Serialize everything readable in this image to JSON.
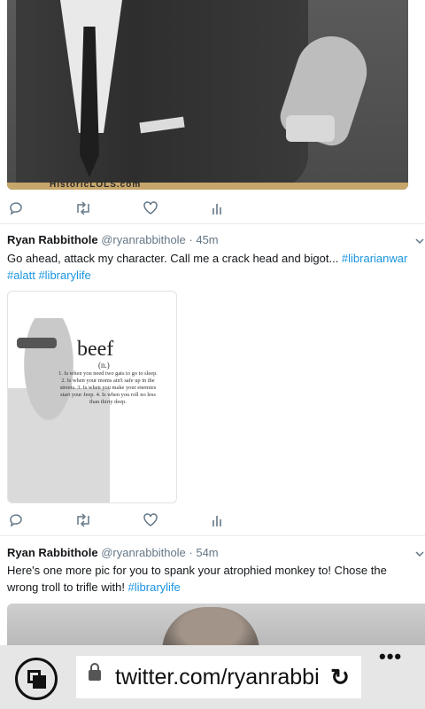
{
  "tweets": [
    {
      "image_watermark": "HistoricLOLS.com"
    },
    {
      "name": "Ryan Rabbithole",
      "meta": "@ryanrabbithole · 45m",
      "text_plain": "Go ahead, attack my character. Call me a crack head and bigot... ",
      "hashtags": [
        "#librarianwar",
        "#alatt",
        "#librarylife"
      ],
      "image_card": {
        "word": "beef",
        "part_of_speech": "(n.)",
        "definition": "1. Is when you need two gats to go to sleep. 2. Is when your moms ain't safe up in the streets. 3. Is when you make your enemies start your Jeep. 4. Is when you roll no less than thirty deep."
      }
    },
    {
      "name": "Ryan Rabbithole",
      "meta": "@ryanrabbithole · 54m",
      "text_plain": "Here's one more pic for you to spank your atrophied monkey to! Chose the wrong troll to trifle with! ",
      "hashtags": [
        "#librarylife"
      ]
    }
  ],
  "icons": {
    "reply": "reply-icon",
    "retweet": "retweet-icon",
    "like": "heart-icon",
    "analytics": "analytics-icon"
  },
  "browser": {
    "url": "twitter.com/ryanrabbi",
    "more": "•••"
  },
  "colors": {
    "link": "#1b95e0",
    "muted": "#657786",
    "browser_bar": "#e6e6e6"
  }
}
